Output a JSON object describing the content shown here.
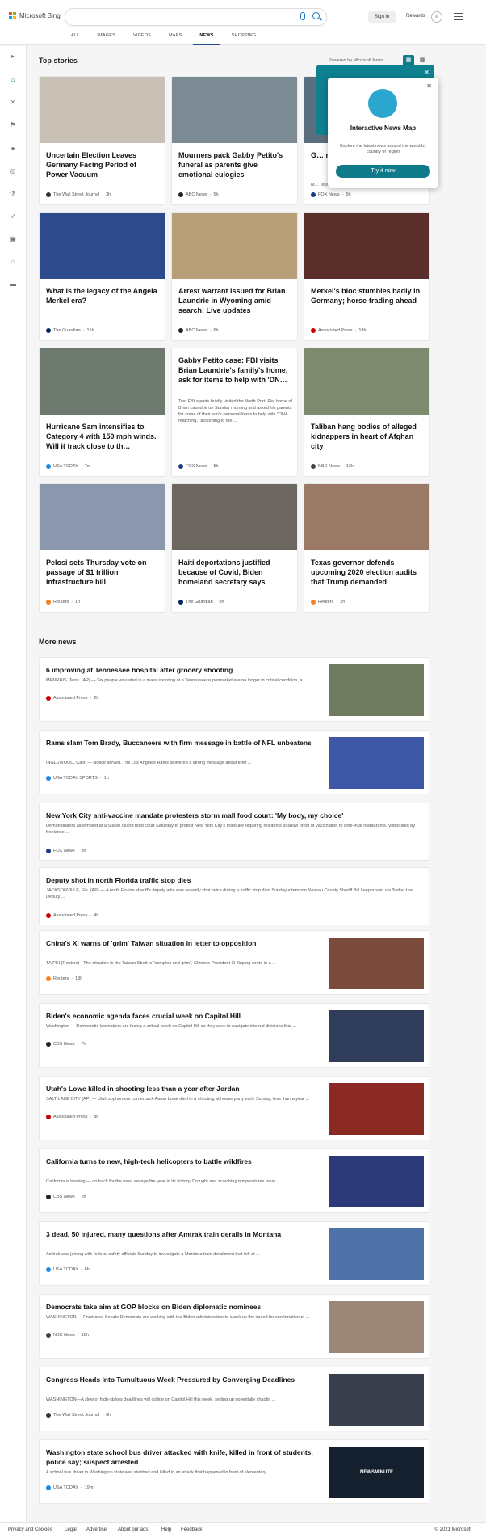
{
  "header": {
    "brand": "Microsoft Bing",
    "search_placeholder": "",
    "signin": "Sign in",
    "rewards": "Rewards",
    "tabs": [
      "ALL",
      "IMAGES",
      "VIDEOS",
      "MAPS",
      "NEWS",
      "SHOPPING"
    ],
    "active_tab": "NEWS"
  },
  "top_stories": {
    "heading": "Top stories",
    "powered_by": "Powered by Microsoft News",
    "cards": [
      {
        "title": "Uncertain Election Leaves Germany Facing Period of Power Vacuum",
        "source": "The Wall Street Journal",
        "time": "3h",
        "img_color": "#c9c0b6",
        "src_color": "#333"
      },
      {
        "title": "Mourners pack Gabby Petito's funeral as parents give emotional eulogies",
        "source": "ABC News",
        "time": "5h",
        "img_color": "#7b8a93",
        "src_color": "#222"
      },
      {
        "title": "G… re… w…",
        "snippet": "M… report… off in a… plates,… and Ga…",
        "source": "FOX News",
        "time": "5h",
        "img_color": "#5b6e7e",
        "src_color": "#1d3b8c"
      },
      {
        "title": "What is the legacy of the Angela Merkel era?",
        "source": "The Guardian",
        "time": "15h",
        "img_color": "#2d4a8c",
        "src_color": "#052962"
      },
      {
        "title": "Arrest warrant issued for Brian Laundrie in Wyoming amid search: Live updates",
        "source": "ABC News",
        "time": "6h",
        "img_color": "#b99e7a",
        "src_color": "#222"
      },
      {
        "title": "Merkel's bloc stumbles badly in Germany; horse-trading ahead",
        "source": "Associated Press",
        "time": "18h",
        "img_color": "#5a2e2a",
        "src_color": "#c00"
      },
      {
        "title": "Hurricane Sam intensifies to Category 4 with 150 mph winds. Will it track close to th…",
        "source": "USA TODAY",
        "time": "7m",
        "img_color": "#6e7a6f",
        "src_color": "#1e88e5"
      },
      {
        "title": "Gabby Petito case: FBI visits Brian Laundrie's family's home, ask for items to help with 'DN…",
        "snippet": "Two FBI agents briefly visited the North Port, Fla. home of Brian Laundrie on Sunday morning and asked his parents for some of their son's personal items to help with \"DNA matching,\" according to the ...",
        "source": "FOX News",
        "time": "5h",
        "img_color": "#fff",
        "src_color": "#1d3b8c"
      },
      {
        "title": "Taliban hang bodies of alleged kidnappers in heart of Afghan city",
        "source": "NBC News",
        "time": "13h",
        "img_color": "#7d8a6e",
        "src_color": "#444"
      },
      {
        "title": "Pelosi sets Thursday vote on passage of $1 trillion infrastructure bill",
        "source": "Reuters",
        "time": "1h",
        "img_color": "#8a97ad",
        "src_color": "#f58220"
      },
      {
        "title": "Haiti deportations justified because of Covid, Biden homeland secretary says",
        "source": "The Guardian",
        "time": "8h",
        "img_color": "#6b6660",
        "src_color": "#052962"
      },
      {
        "title": "Texas governor defends upcoming 2020 election audits that Trump demanded",
        "source": "Reuters",
        "time": "2h",
        "img_color": "#9a7a66",
        "src_color": "#f58220"
      }
    ]
  },
  "map_popup": {
    "title": "Interactive News Map",
    "description": "Explore the latest news around the world by country or region",
    "button": "Try it now"
  },
  "more_news": {
    "heading": "More news",
    "items": [
      {
        "title": "6 improving at Tennessee hospital after grocery shooting",
        "snippet": "MEMPHIS, Tenn. (AP) — Six people wounded in a mass shooting at a Tennessee supermarket are no longer in critical condition, a ...",
        "source": "Associated Press",
        "time": "2h",
        "thumb": "#6f7a5e",
        "src_color": "#c00"
      },
      {
        "title": "Rams slam Tom Brady, Buccaneers with firm message in battle of NFL unbeatens",
        "snippet": "INGLEWOOD, Calif. — Notice served. The Los Angeles Rams delivered a strong message about their ...",
        "source": "USA TODAY SPORTS",
        "time": "1h",
        "thumb": "#3d56a6",
        "src_color": "#1e88e5"
      },
      {
        "title": "New York City anti-vaccine mandate protesters storm mall food court: 'My body, my choice'",
        "snippet": "Demonstrators assembled at a Staten Island food court Saturday to protest New York City's mandate requiring residents to show proof of vaccination to dine-in at restaurants.  Video shot by freelance ...",
        "source": "FOX News",
        "time": "3h",
        "thumb": "",
        "src_color": "#1d3b8c"
      },
      {
        "title": "Deputy shot in north Florida traffic stop dies",
        "snippet": "JACKSONVILLE, Fla. (AP) — A north Florida sheriff's deputy who was recently shot twice during a traffic stop died Sunday afternoon Nassau County Sheriff Bill Leeper said via Twitter that Deputy ...",
        "source": "Associated Press",
        "time": "4h",
        "thumb": "",
        "src_color": "#c00"
      },
      {
        "title": "China's Xi warns of 'grim' Taiwan situation in letter to opposition",
        "snippet": "TAIPEI (Reuters) - The situation in the Taiwan Strait is \"complex and grim\", Chinese President Xi Jinping wrote in a ...",
        "source": "Reuters",
        "time": "18h",
        "thumb": "#7a4a3a",
        "src_color": "#f58220"
      },
      {
        "title": "Biden's economic agenda faces crucial week on Capitol Hill",
        "snippet": "Washington — Democratic lawmakers are facing a critical week on Capitol Hill as they seek to navigate internal divisions that ...",
        "source": "CBS News",
        "time": "7h",
        "thumb": "#2f3d5a",
        "src_color": "#222"
      },
      {
        "title": "Utah's Lowe killed in shooting less than a year after Jordan",
        "snippet": "SALT LAKE CITY (AP) — Utah sophomore cornerback Aaron Lowe died in a shooting at house party early Sunday, less than a year ...",
        "source": "Associated Press",
        "time": "8h",
        "thumb": "#8a2a22",
        "src_color": "#c00"
      },
      {
        "title": "California turns to new, high-tech helicopters to battle wildfires",
        "snippet": "California is burning — on track for the most savage fire year in its history. Drought and scorching temperatures have ...",
        "source": "CBS News",
        "time": "2h",
        "thumb": "#2d3a7a",
        "src_color": "#222"
      },
      {
        "title": "3 dead, 50 injured, many questions after Amtrak train derails in Montana",
        "snippet": "Amtrak was joining with federal safety officials Sunday to investigate a Montana train derailment that left at ...",
        "source": "USA TODAY",
        "time": "6h",
        "thumb": "#4f72a8",
        "src_color": "#1e88e5"
      },
      {
        "title": "Democrats take aim at GOP blocks on Biden diplomatic nominees",
        "snippet": "WASHINGTON — Frustrated Senate Democrats are working with the Biden administration to crank up the speed for confirmation of ...",
        "source": "NBC News",
        "time": "16h",
        "thumb": "#9c8678",
        "src_color": "#444"
      },
      {
        "title": "Congress Heads Into Tumultuous Week Pressured by Converging Deadlines",
        "snippet": "WASHINGTON—A slew of high-stakes deadlines will collide on Capitol Hill this week, setting up potentially chaotic ...",
        "source": "The Wall Street Journal",
        "time": "6h",
        "thumb": "#3a3f4e",
        "src_color": "#333"
      },
      {
        "title": "Washington state school bus driver attacked with knife, killed in front of students, police say; suspect arrested",
        "snippet": "A school bus driver in Washington state was stabbed and killed in an attack that happened in front of elementary ...",
        "source": "USA TODAY",
        "time": "19m",
        "thumb": "#14202e",
        "thumb_label": "NEWSMINUTE",
        "src_color": "#1e88e5"
      }
    ]
  },
  "footer": {
    "links": [
      "Privacy and Cookies",
      "Legal",
      "Advertise",
      "About our ads",
      "Help",
      "Feedback"
    ],
    "copyright": "© 2021 Microsoft"
  }
}
